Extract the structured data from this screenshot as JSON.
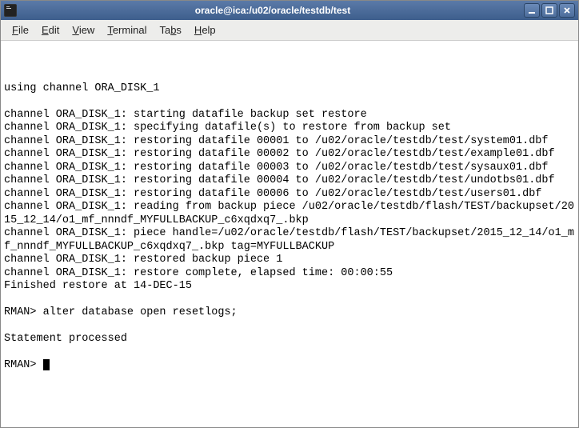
{
  "titlebar": {
    "title": "oracle@ica:/u02/oracle/testdb/test"
  },
  "menubar": {
    "file": "File",
    "edit": "Edit",
    "view": "View",
    "terminal": "Terminal",
    "tabs": "Tabs",
    "help": "Help"
  },
  "terminal": {
    "lines": [
      "",
      "using channel ORA_DISK_1",
      "",
      "channel ORA_DISK_1: starting datafile backup set restore",
      "channel ORA_DISK_1: specifying datafile(s) to restore from backup set",
      "channel ORA_DISK_1: restoring datafile 00001 to /u02/oracle/testdb/test/system01.dbf",
      "channel ORA_DISK_1: restoring datafile 00002 to /u02/oracle/testdb/test/example01.dbf",
      "channel ORA_DISK_1: restoring datafile 00003 to /u02/oracle/testdb/test/sysaux01.dbf",
      "channel ORA_DISK_1: restoring datafile 00004 to /u02/oracle/testdb/test/undotbs01.dbf",
      "channel ORA_DISK_1: restoring datafile 00006 to /u02/oracle/testdb/test/users01.dbf",
      "channel ORA_DISK_1: reading from backup piece /u02/oracle/testdb/flash/TEST/backupset/2015_12_14/o1_mf_nnndf_MYFULLBACKUP_c6xqdxq7_.bkp",
      "channel ORA_DISK_1: piece handle=/u02/oracle/testdb/flash/TEST/backupset/2015_12_14/o1_mf_nnndf_MYFULLBACKUP_c6xqdxq7_.bkp tag=MYFULLBACKUP",
      "channel ORA_DISK_1: restored backup piece 1",
      "channel ORA_DISK_1: restore complete, elapsed time: 00:00:55",
      "Finished restore at 14-DEC-15",
      "",
      "RMAN> alter database open resetlogs;",
      "",
      "Statement processed",
      ""
    ],
    "prompt": "RMAN> "
  }
}
